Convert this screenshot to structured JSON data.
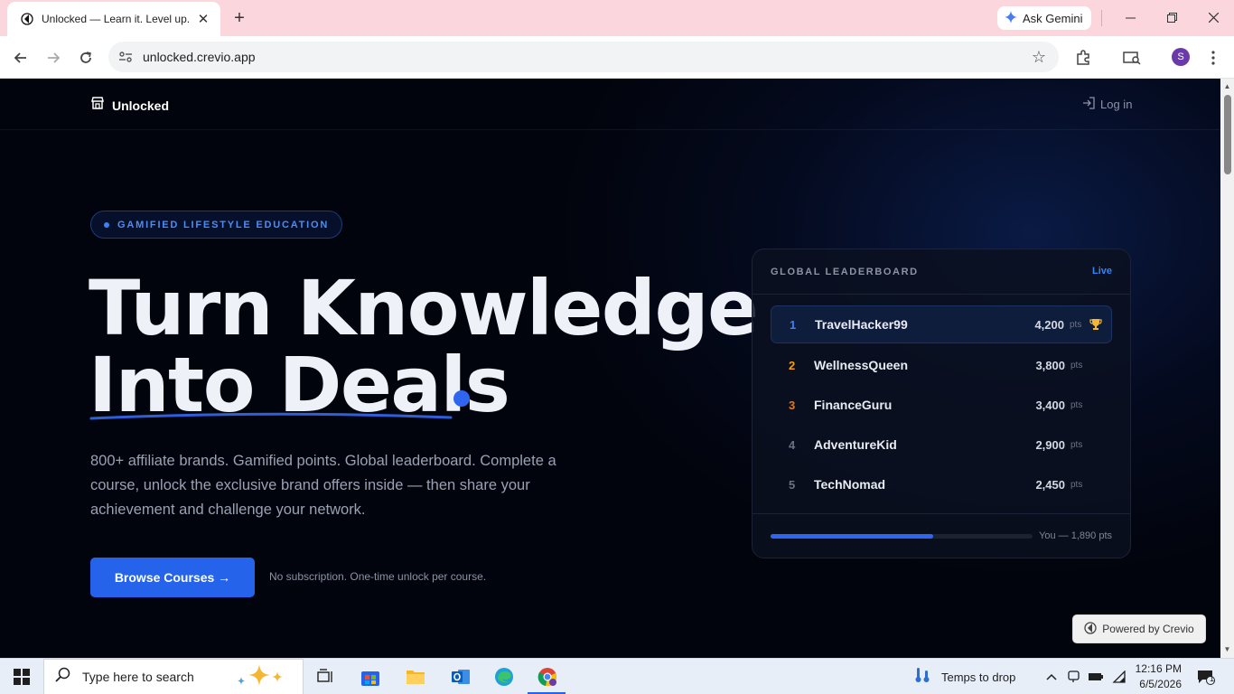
{
  "browser": {
    "tab_title": "Unlocked — Learn it. Level up.",
    "tab_close": "✕",
    "new_tab": "+",
    "gemini_label": "Ask Gemini",
    "url": "unlocked.crevio.app",
    "profile_initial": "S"
  },
  "nav": {
    "brand": "Unlocked",
    "login": "Log in"
  },
  "hero": {
    "eyebrow": "GAMIFIED LIFESTYLE EDUCATION",
    "headline_line1": "Turn Knowledge",
    "headline_line2": "Into Deals",
    "subtitle": "800+ affiliate brands. Gamified points. Global leaderboard. Complete a course, unlock the exclusive brand offers inside — then share your achievement and challenge your network.",
    "cta_label": "Browse Courses →",
    "cta_note": "No subscription. One-time unlock per course."
  },
  "leaderboard": {
    "title": "GLOBAL LEADERBOARD",
    "status": "Live",
    "rows": [
      {
        "rank": "1",
        "name": "TravelHacker99",
        "points": "4,200",
        "unit": "pts",
        "rank_color": "#3b82f6"
      },
      {
        "rank": "2",
        "name": "WellnessQueen",
        "points": "3,800",
        "unit": "pts",
        "rank_color": "#f59e0b"
      },
      {
        "rank": "3",
        "name": "FinanceGuru",
        "points": "3,400",
        "unit": "pts",
        "rank_color": "#d97a2b"
      },
      {
        "rank": "4",
        "name": "AdventureKid",
        "points": "2,900",
        "unit": "pts",
        "rank_color": "#6b7280"
      },
      {
        "rank": "5",
        "name": "TechNomad",
        "points": "2,450",
        "unit": "pts",
        "rank_color": "#6b7280"
      }
    ],
    "you_label": "You — 1,890 pts",
    "you_progress": 0.62
  },
  "powered_by": "Powered by Crevio",
  "taskbar": {
    "search_placeholder": "Type here to search",
    "weather": "Temps to drop",
    "time": "12:16 PM",
    "date": "6/5/2026",
    "notification_count": "1"
  },
  "colors": {
    "accent": "#2563eb",
    "background": "#02040d",
    "tabstrip": "#fbd6dc"
  }
}
